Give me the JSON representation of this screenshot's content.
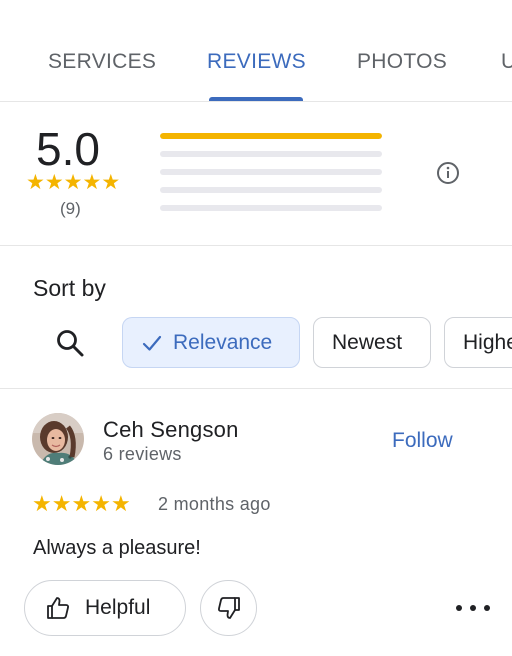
{
  "tabs": [
    {
      "label": "SERVICES",
      "active": false
    },
    {
      "label": "REVIEWS",
      "active": true
    },
    {
      "label": "PHOTOS",
      "active": false
    },
    {
      "label": "U",
      "active": false
    }
  ],
  "summary": {
    "rating": "5.0",
    "star_count": 5,
    "review_count": "(9)",
    "distribution": [
      {
        "stars": 5,
        "fraction": 1.0
      },
      {
        "stars": 4,
        "fraction": 0.0
      },
      {
        "stars": 3,
        "fraction": 0.0
      },
      {
        "stars": 2,
        "fraction": 0.0
      },
      {
        "stars": 1,
        "fraction": 0.0
      }
    ],
    "info_icon": "info-icon"
  },
  "sort": {
    "title": "Sort by",
    "search_icon": "search-icon",
    "chips": [
      {
        "label": "Relevance",
        "selected": true
      },
      {
        "label": "Newest",
        "selected": false
      },
      {
        "label": "Highest",
        "selected": false
      }
    ]
  },
  "review": {
    "reviewer_name": "Ceh Sengson",
    "reviewer_reviews": "6 reviews",
    "follow_label": "Follow",
    "rating": 5,
    "time": "2 months ago",
    "text": "Always a pleasure!",
    "helpful_label": "Helpful",
    "more_icon": "more-horizontal-icon"
  },
  "colors": {
    "accent": "#3c6bbd",
    "star": "#f4b400",
    "selected_chip_bg": "#e8f0fe"
  }
}
